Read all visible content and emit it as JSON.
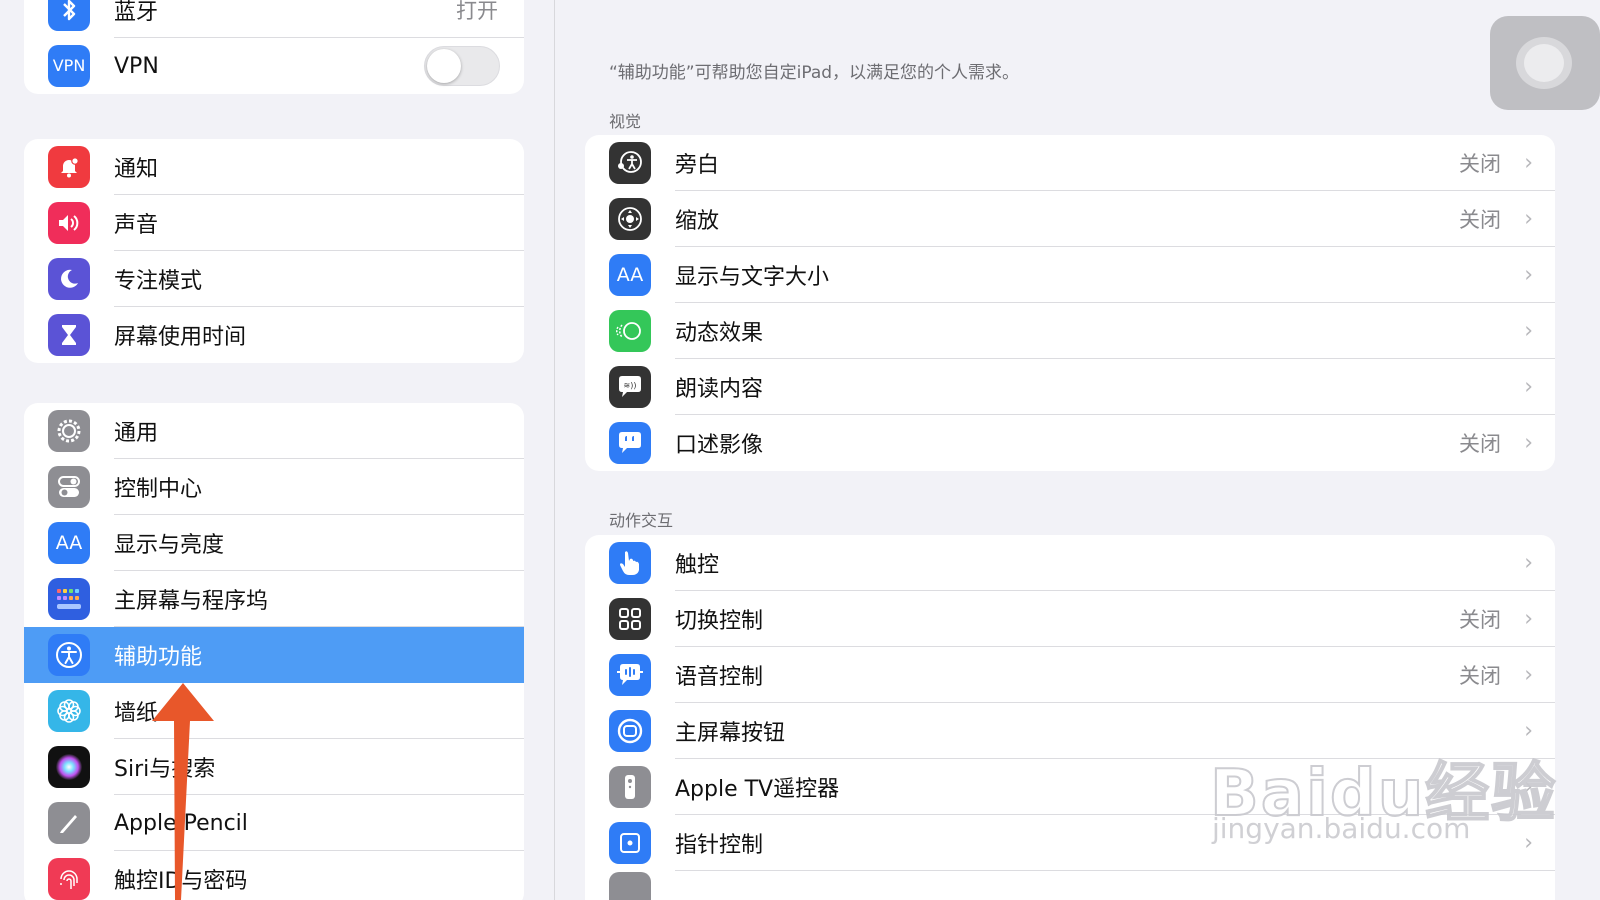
{
  "sidebar": {
    "top_group": [
      {
        "label": "蓝牙",
        "value": "打开",
        "icon": "bluetooth-icon"
      },
      {
        "label": "VPN",
        "icon": "vpn-icon",
        "icon_text": "VPN",
        "toggle_on": false
      }
    ],
    "group2": [
      {
        "label": "通知",
        "icon": "notification-icon"
      },
      {
        "label": "声音",
        "icon": "speaker-icon"
      },
      {
        "label": "专注模式",
        "icon": "moon-icon"
      },
      {
        "label": "屏幕使用时间",
        "icon": "hourglass-icon"
      }
    ],
    "group3": [
      {
        "label": "通用",
        "icon": "gear-icon"
      },
      {
        "label": "控制中心",
        "icon": "toggles-icon"
      },
      {
        "label": "显示与亮度",
        "icon": "text-size-icon",
        "icon_text": "AA"
      },
      {
        "label": "主屏幕与程序坞",
        "icon": "home-grid-icon"
      },
      {
        "label": "辅助功能",
        "icon": "accessibility-icon",
        "selected": true
      },
      {
        "label": "墙纸",
        "icon": "flower-icon"
      },
      {
        "label": "Siri与搜索",
        "icon": "siri-icon"
      },
      {
        "label": "Apple Pencil",
        "icon": "pencil-icon"
      },
      {
        "label": "触控ID与密码",
        "icon": "fingerprint-icon"
      }
    ]
  },
  "main": {
    "intro": "“辅助功能”可帮助您自定iPad，以满足您的个人需求。",
    "section_vision": "视觉",
    "vision_items": [
      {
        "label": "旁白",
        "value": "关闭",
        "icon": "voiceover-icon"
      },
      {
        "label": "缩放",
        "value": "关闭",
        "icon": "zoom-icon"
      },
      {
        "label": "显示与文字大小",
        "value": "",
        "icon": "text-size-icon",
        "icon_text": "AA"
      },
      {
        "label": "动态效果",
        "value": "",
        "icon": "motion-icon"
      },
      {
        "label": "朗读内容",
        "value": "",
        "icon": "speech-bubble-icon"
      },
      {
        "label": "口述影像",
        "value": "关闭",
        "icon": "audio-description-icon"
      }
    ],
    "section_interaction": "动作交互",
    "interaction_items": [
      {
        "label": "触控",
        "value": "",
        "icon": "hand-icon"
      },
      {
        "label": "切换控制",
        "value": "关闭",
        "icon": "grid-icon"
      },
      {
        "label": "语音控制",
        "value": "关闭",
        "icon": "voice-control-icon"
      },
      {
        "label": "主屏幕按钮",
        "value": "",
        "icon": "home-button-icon"
      },
      {
        "label": "Apple TV遥控器",
        "value": "",
        "icon": "remote-icon"
      },
      {
        "label": "指针控制",
        "value": "",
        "icon": "pointer-icon"
      }
    ],
    "chevron": "›"
  },
  "watermark": {
    "brand": "Baidu经验",
    "url": "jingyan.baidu.com"
  },
  "colors": {
    "selected_row": "#4e9cf5",
    "arrow": "#e8572a",
    "background": "#f2f2f7"
  }
}
